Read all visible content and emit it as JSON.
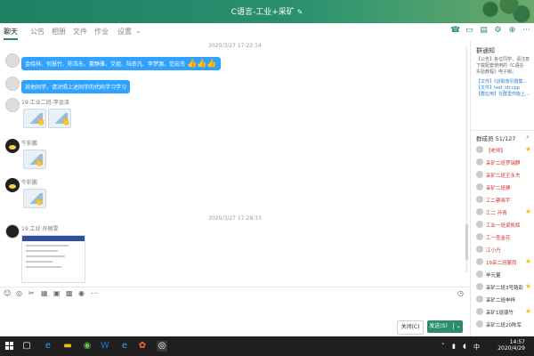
{
  "window": {
    "title": "C语言-工业+采矿"
  },
  "tabs": [
    {
      "label": "聊天",
      "active": true
    },
    {
      "label": "公告",
      "active": false
    },
    {
      "label": "相册",
      "active": false
    },
    {
      "label": "文件",
      "active": false
    },
    {
      "label": "作业",
      "active": false
    },
    {
      "label": "设置",
      "active": false
    }
  ],
  "chat": {
    "timestamps": [
      "2020/3/27 17:22:14",
      "2020/3/27 17:28:33"
    ],
    "messages": [
      {
        "type": "text",
        "text": "金晓祥、何慧竹、陈浩东、蒙静雅、艾姐、陆依凡、李梦源、范宏杰"
      },
      {
        "type": "text",
        "text": "其他同学，请对照上述同学的代码学习学习"
      },
      {
        "sender": "19-工业二班-李金泽",
        "type": "image"
      },
      {
        "sender": "牛彩鹏",
        "type": "image"
      },
      {
        "sender": "牛彩鹏",
        "type": "image"
      },
      {
        "sender": "19 工业 孙丽雯",
        "type": "image"
      }
    ]
  },
  "composer": {
    "close_label": "关闭(C)",
    "send_label": "发送(S)"
  },
  "right_panel": {
    "notice_title": "群通知",
    "notice_lines": [
      "【公告】各位同学，请注意",
      "下载配套使用的《C语言",
      "实验教程》电子版。",
      "【文件】《进取落引题集...",
      "【文件】test_str.cpp",
      "【群应用】在群里你能上..."
    ],
    "members_title": "群成员 51/127",
    "members": [
      {
        "name": "【老师】",
        "color": "#d03030"
      },
      {
        "name": "采矿二班罗瑞麒",
        "color": "#d03030"
      },
      {
        "name": "采矿二班王永杰",
        "color": "#d03030"
      },
      {
        "name": "采矿二班静",
        "color": "#d03030"
      },
      {
        "name": "工二蔡晓宇",
        "color": "#d03030"
      },
      {
        "name": "工二 孙青",
        "color": "#d03030"
      },
      {
        "name": "工业一班梁凯辉",
        "color": "#d03030"
      },
      {
        "name": "工一查金花",
        "color": "#d03030"
      },
      {
        "name": "江小丹",
        "color": "#d03030"
      },
      {
        "name": "19采二班蒙雨",
        "color": "#d03030"
      },
      {
        "name": "毕元量",
        "color": "#333333"
      },
      {
        "name": "采矿二班3号路彭",
        "color": "#333333"
      },
      {
        "name": "采矿二班申梓",
        "color": "#333333"
      },
      {
        "name": "采矿1班康竹",
        "color": "#333333"
      },
      {
        "name": "采矿二班20陈军",
        "color": "#333333"
      }
    ]
  },
  "taskbar": {
    "time": "14:57",
    "date": "2020/4/29",
    "ime": "中"
  }
}
